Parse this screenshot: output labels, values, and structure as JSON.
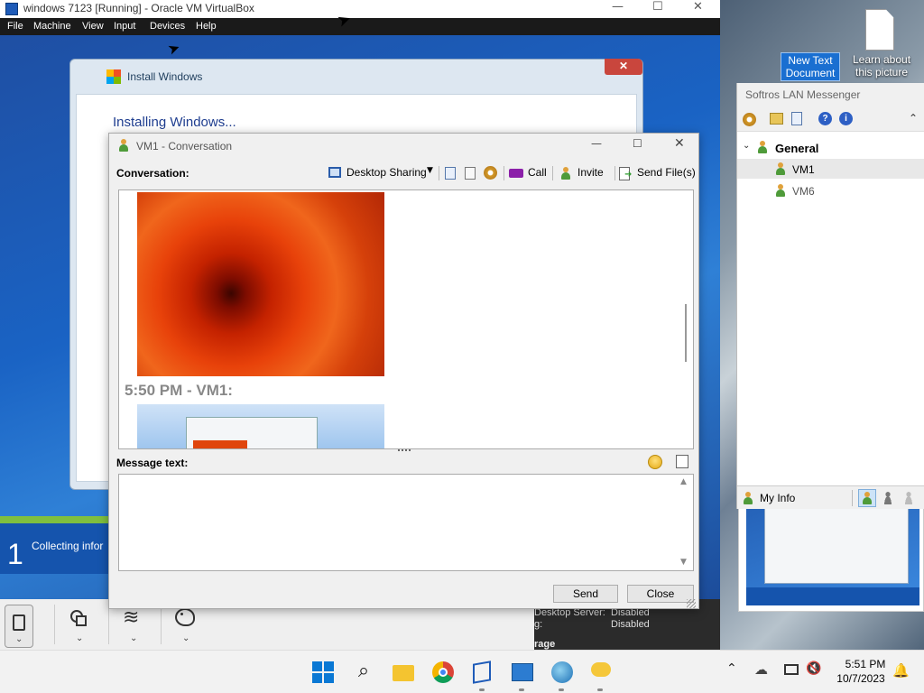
{
  "vbox": {
    "title": "windows 7123 [Running] - Oracle VM VirtualBox",
    "menu": [
      "File",
      "Machine",
      "View",
      "Input",
      "Devices",
      "Help"
    ]
  },
  "guest": {
    "install_title": "Install Windows",
    "install_heading": "Installing Windows...",
    "step_number": "1",
    "step_text": "Collecting infor"
  },
  "conversation": {
    "title": "VM1 - Conversation",
    "label": "Conversation:",
    "desktop_sharing": "Desktop Sharing",
    "call": "Call",
    "invite": "Invite",
    "send_files": "Send File(s)",
    "timestamp": "5:50 PM - VM1:",
    "message_label": "Message text:",
    "send": "Send",
    "close": "Close"
  },
  "messenger": {
    "title": "Softros LAN Messenger",
    "group": "General",
    "users": [
      "VM1",
      "VM6"
    ],
    "my_info": "My Info"
  },
  "desktop_icons": {
    "new_text_document": "New Text Document",
    "learn_about": "Learn about this picture"
  },
  "vm_details": {
    "line1_label": "Desktop Server:",
    "line1_value": "Disabled",
    "line2_label": "g:",
    "line2_value": "Disabled",
    "line3": "rage"
  },
  "taskbar": {
    "time": "5:51 PM",
    "date": "10/7/2023"
  },
  "colors": {
    "accent": "#0067c0",
    "call_icon": "#8b1fa9",
    "guest_blue": "#1a63c4"
  }
}
